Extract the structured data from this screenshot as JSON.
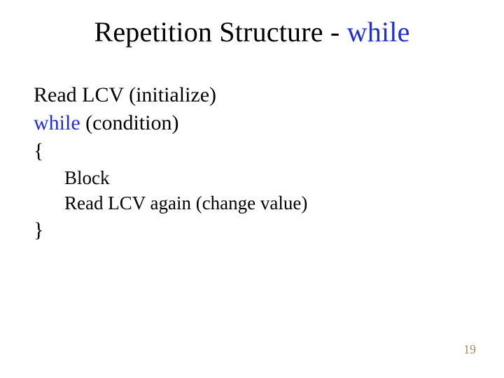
{
  "title": {
    "prefix": "Repetition Structure - ",
    "keyword": "while"
  },
  "lines": {
    "l1": "Read LCV (initialize)",
    "l2_kw": "while",
    "l2_rest": " (condition)",
    "l3": "{",
    "l4": "Block",
    "l5": "Read LCV again (change value)",
    "l6": "}"
  },
  "page_number": "19"
}
